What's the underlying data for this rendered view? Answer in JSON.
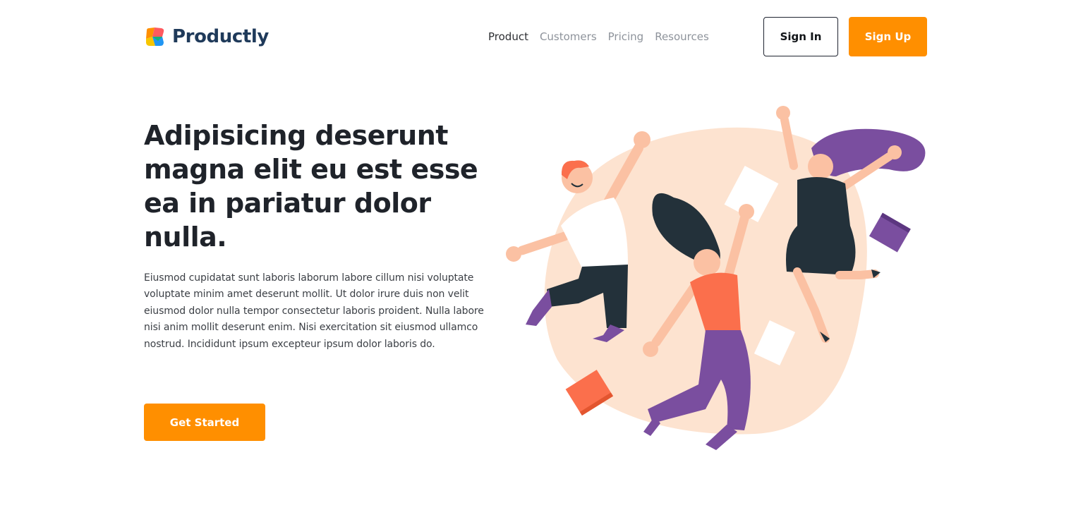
{
  "header": {
    "brand": "Productly",
    "logo_icon": "productly-logo-icon",
    "nav": [
      {
        "label": "Product",
        "active": true
      },
      {
        "label": "Customers",
        "active": false
      },
      {
        "label": "Pricing",
        "active": false
      },
      {
        "label": "Resources",
        "active": false
      }
    ],
    "sign_in_label": "Sign In",
    "sign_up_label": "Sign Up"
  },
  "hero": {
    "title": "Adipisicing deserunt magna elit eu est esse ea in pariatur dolor nulla.",
    "description": "Eiusmod cupidatat sunt laboris laborum labore cillum nisi voluptate voluptate minim amet deserunt mollit. Ut dolor irure duis non velit eiusmod dolor nulla tempor consectetur laboris proident. Nulla labore nisi anim mollit deserunt enim. Nisi exercitation sit eiusmod ullamco nostrud. Incididunt ipsum excepteur ipsum dolor laboris do.",
    "cta_label": "Get Started",
    "illustration": "jumping-people-illustration"
  },
  "colors": {
    "accent": "#ff8f00",
    "brand_text": "#1f3a5a",
    "heading": "#1f232a",
    "blob": "#fde3d0",
    "purple": "#7a4e9f",
    "coral": "#fb6f4c",
    "dark": "#23313a"
  }
}
